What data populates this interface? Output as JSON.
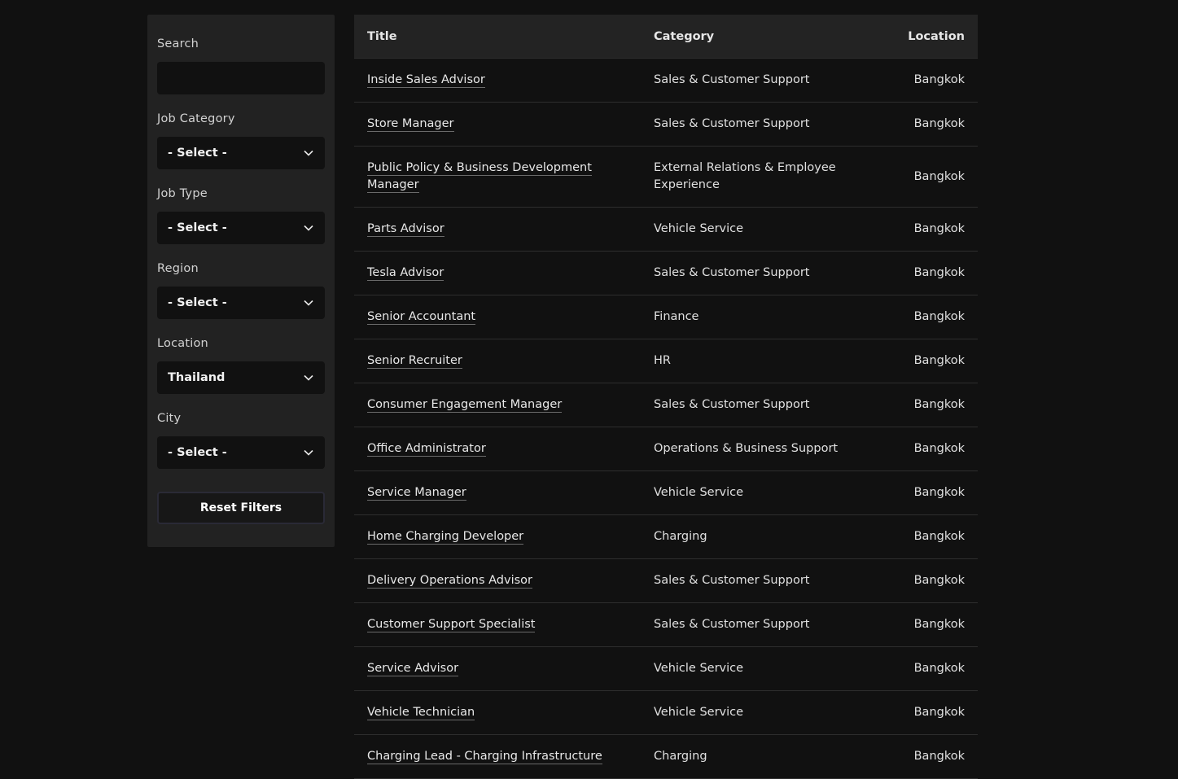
{
  "filters": {
    "search_label": "Search",
    "search_value": "",
    "search_placeholder": "",
    "job_category_label": "Job Category",
    "job_category_value": "- Select -",
    "job_type_label": "Job Type",
    "job_type_value": "- Select -",
    "region_label": "Region",
    "region_value": "- Select -",
    "location_label": "Location",
    "location_value": "Thailand",
    "city_label": "City",
    "city_value": "- Select -",
    "reset_label": "Reset Filters"
  },
  "table": {
    "headers": {
      "title": "Title",
      "category": "Category",
      "location": "Location"
    },
    "rows": [
      {
        "title": "Inside Sales Advisor",
        "category": "Sales & Customer Support",
        "location": "Bangkok"
      },
      {
        "title": "Store Manager",
        "category": "Sales & Customer Support",
        "location": "Bangkok"
      },
      {
        "title": "Public Policy & Business Development Manager",
        "category": "External Relations & Employee Experience",
        "location": "Bangkok"
      },
      {
        "title": "Parts Advisor",
        "category": "Vehicle Service",
        "location": "Bangkok"
      },
      {
        "title": "Tesla Advisor",
        "category": "Sales & Customer Support",
        "location": "Bangkok"
      },
      {
        "title": "Senior Accountant",
        "category": "Finance",
        "location": "Bangkok"
      },
      {
        "title": "Senior Recruiter",
        "category": "HR",
        "location": "Bangkok"
      },
      {
        "title": "Consumer Engagement Manager",
        "category": "Sales & Customer Support",
        "location": "Bangkok"
      },
      {
        "title": "Office Administrator",
        "category": "Operations & Business Support",
        "location": "Bangkok"
      },
      {
        "title": "Service Manager",
        "category": "Vehicle Service",
        "location": "Bangkok"
      },
      {
        "title": "Home Charging Developer",
        "category": "Charging",
        "location": "Bangkok"
      },
      {
        "title": "Delivery Operations Advisor",
        "category": "Sales & Customer Support",
        "location": "Bangkok"
      },
      {
        "title": "Customer Support Specialist",
        "category": "Sales & Customer Support",
        "location": "Bangkok"
      },
      {
        "title": "Service Advisor",
        "category": "Vehicle Service",
        "location": "Bangkok"
      },
      {
        "title": "Vehicle Technician",
        "category": "Vehicle Service",
        "location": "Bangkok"
      },
      {
        "title": "Charging Lead - Charging Infrastructure",
        "category": "Charging",
        "location": "Bangkok"
      }
    ]
  },
  "icons": {
    "dropdown": "chevron-down-icon"
  },
  "colors": {
    "background": "#111111",
    "panel": "#222222",
    "header_row": "#232323",
    "divider": "#2e2e2e",
    "text": "#e4e4e4"
  }
}
